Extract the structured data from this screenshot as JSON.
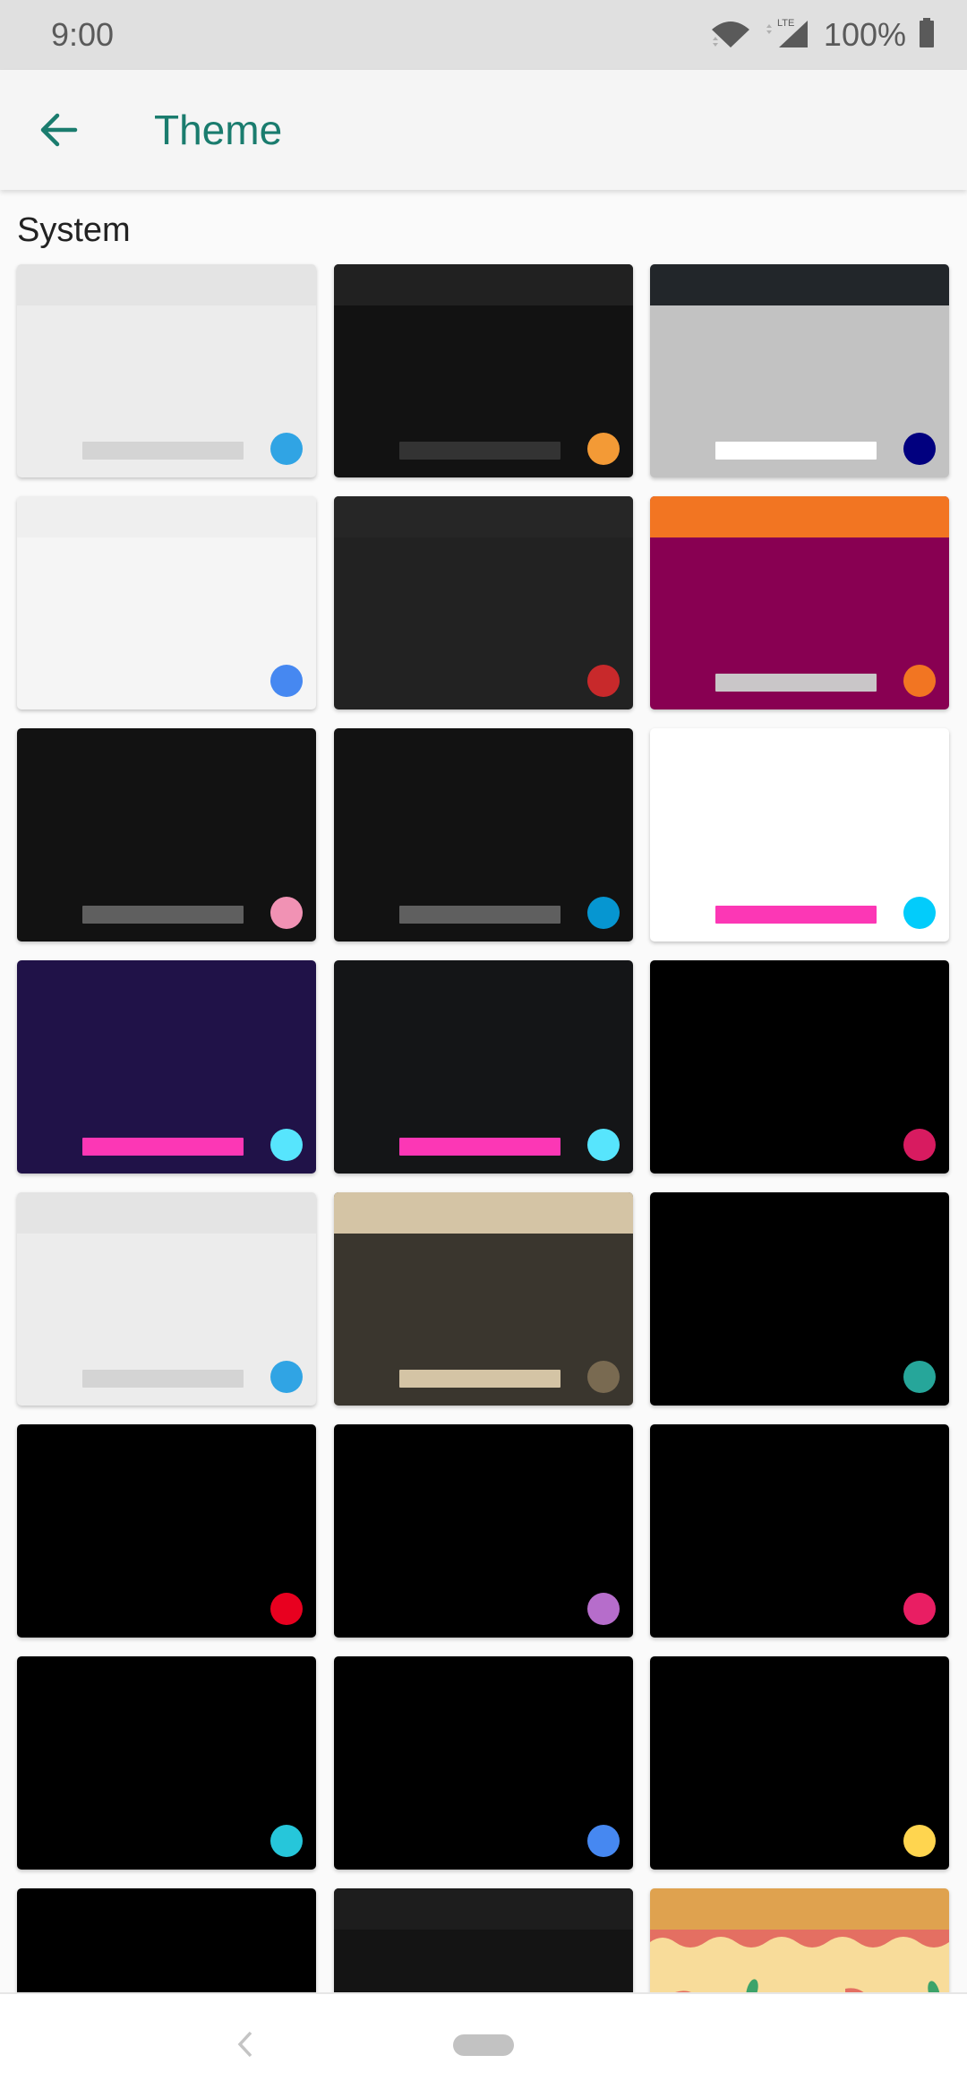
{
  "status_bar": {
    "time": "9:00",
    "battery_percent": "100%",
    "network_label": "LTE",
    "icons": [
      "wifi-icon",
      "cellular-signal-icon",
      "battery-icon"
    ]
  },
  "app_bar": {
    "title": "Theme",
    "back_icon": "arrow-back-icon",
    "accent_color": "#1a7c6e"
  },
  "section": {
    "label": "System"
  },
  "themes": [
    {
      "header": "#e4e4e4",
      "body": "#ececec",
      "bar": "#d4d4d4",
      "dot": "#30a4e4"
    },
    {
      "header": "#212121",
      "body": "#121212",
      "bar": "#333333",
      "dot": "#f39a36"
    },
    {
      "header": "#22262a",
      "body": "#c2c2c2",
      "bar": "#ffffff",
      "dot": "#01007f"
    },
    {
      "header": "#efefef",
      "body": "#f5f5f5",
      "bar": null,
      "dot": "#4688f1"
    },
    {
      "header": "#262626",
      "body": "#222222",
      "bar": null,
      "dot": "#c8292b"
    },
    {
      "header": "#f27522",
      "body": "#880052",
      "bar": "#c9c6c8",
      "dot": "#f27522"
    },
    {
      "header": null,
      "body": "#121212",
      "bar": "#5f5f5f",
      "dot": "#f192b4"
    },
    {
      "header": null,
      "body": "#121212",
      "bar": "#5f5f5f",
      "dot": "#0696d1"
    },
    {
      "header": null,
      "body": "#ffffff",
      "bar": "#fc37b5",
      "dot": "#02ccfb"
    },
    {
      "header": null,
      "body": "#201248",
      "bar": "#fc37b5",
      "dot": "#57e5fd"
    },
    {
      "header": null,
      "body": "#141517",
      "bar": "#fc37b5",
      "dot": "#57e5fd"
    },
    {
      "header": null,
      "body": "#000000",
      "bar": null,
      "dot": "#d81b60"
    },
    {
      "header": "#e4e4e4",
      "body": "#ececec",
      "bar": "#d4d4d4",
      "dot": "#30a4e4"
    },
    {
      "header": "#d4c4a5",
      "body": "#3a362e",
      "bar": "#d4c4a5",
      "dot": "#796a51"
    },
    {
      "header": null,
      "body": "#000000",
      "bar": null,
      "dot": "#26a69a"
    },
    {
      "header": null,
      "body": "#000000",
      "bar": null,
      "dot": "#e8001f"
    },
    {
      "header": null,
      "body": "#000000",
      "bar": null,
      "dot": "#b66dcb"
    },
    {
      "header": null,
      "body": "#000000",
      "bar": null,
      "dot": "#e91e63"
    },
    {
      "header": null,
      "body": "#000000",
      "bar": null,
      "dot": "#26c6da"
    },
    {
      "header": null,
      "body": "#000000",
      "bar": null,
      "dot": "#4688f1"
    },
    {
      "header": null,
      "body": "#000000",
      "bar": null,
      "dot": "#ffd54f"
    },
    {
      "header": null,
      "body": "#000000",
      "bar": null,
      "dot": null
    },
    {
      "header": "#1d1d1d",
      "body": "#141414",
      "bar": null,
      "dot": null
    },
    {
      "header": "#dfa24f",
      "body": "#f8dc9a",
      "bar": null,
      "dot": null,
      "pattern": "pizza"
    }
  ],
  "nav_bar": {
    "back_icon": "nav-back-icon",
    "home_icon": "nav-home-pill"
  }
}
